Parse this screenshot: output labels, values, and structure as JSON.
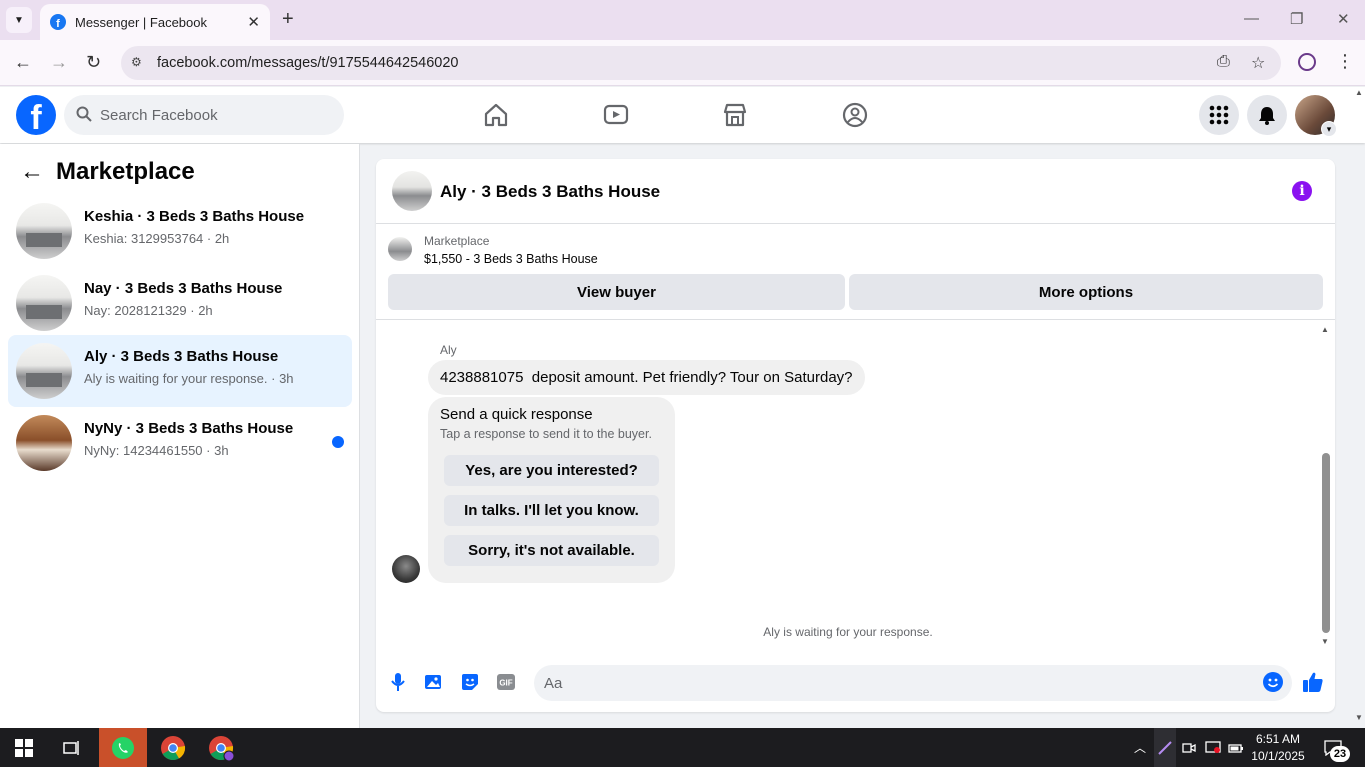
{
  "browser": {
    "tab_title": "Messenger | Facebook",
    "url": "facebook.com/messages/t/9175544642546020"
  },
  "header": {
    "search_placeholder": "Search Facebook"
  },
  "sidebar": {
    "title": "Marketplace",
    "conversations": [
      {
        "name": "Keshia · 3 Beds 3 Baths House",
        "preview": "Keshia: 3129953764 · 2h",
        "active": false,
        "unread": false
      },
      {
        "name": "Nay · 3 Beds 3 Baths House",
        "preview": "Nay: 2028121329 · 2h",
        "active": false,
        "unread": false
      },
      {
        "name": "Aly · 3 Beds 3 Baths House",
        "preview": "Aly is waiting for your response. · 3h",
        "active": true,
        "unread": false
      },
      {
        "name": "NyNy · 3 Beds 3 Baths House",
        "preview": "NyNy: 14234461550 · 3h",
        "active": false,
        "unread": true
      }
    ]
  },
  "chat": {
    "title": "Aly · 3 Beds 3 Baths House",
    "listing_label": "Marketplace",
    "listing_price": "$1,550 - 3 Beds 3 Baths House",
    "view_buyer": "View buyer",
    "more_options": "More options",
    "sender": "Aly",
    "message": "4238881075  deposit amount. Pet friendly? Tour on Saturday?",
    "quick_title": "Send a quick response",
    "quick_subtitle": "Tap a response to send it to the buyer.",
    "quick_options": [
      "Yes, are you interested?",
      "In talks. I'll let you know.",
      "Sorry, it's not available."
    ],
    "waiting_text": "Aly is waiting for your response.",
    "composer_placeholder": "Aa"
  },
  "taskbar": {
    "time": "6:51 AM",
    "date": "10/1/2025",
    "notification_count": "23"
  },
  "colors": {
    "facebook_blue": "#0866ff",
    "info_purple": "#8a12f0",
    "active_row": "#e7f3ff",
    "whatsapp_bg": "#c9502a"
  }
}
